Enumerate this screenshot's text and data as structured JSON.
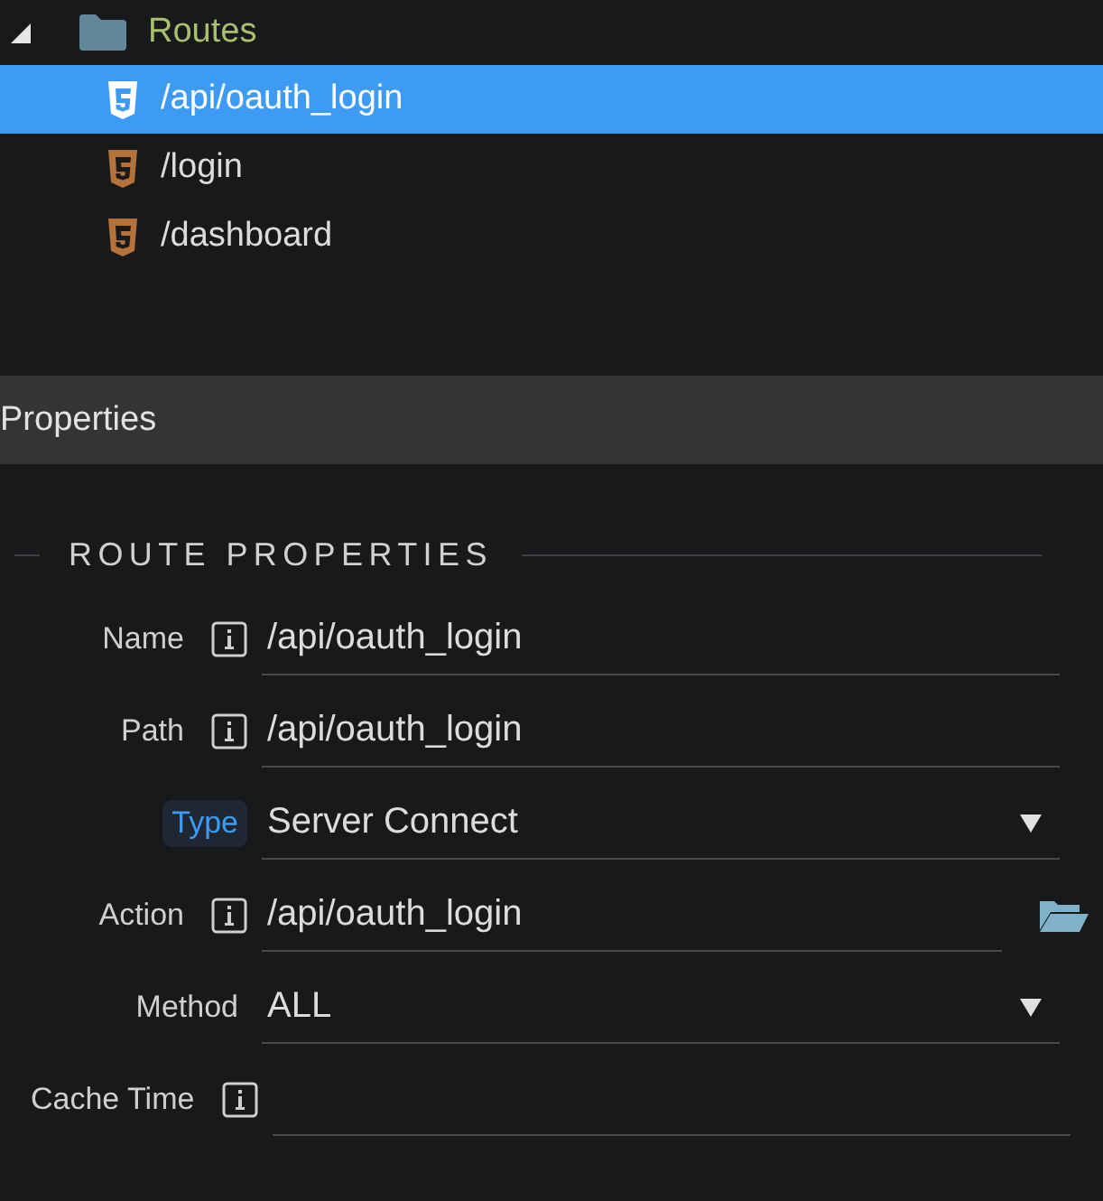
{
  "tree": {
    "folder": {
      "label": "Routes",
      "expanded": true
    },
    "items": [
      {
        "label": "/api/oauth_login",
        "selected": true
      },
      {
        "label": "/login",
        "selected": false
      },
      {
        "label": "/dashboard",
        "selected": false
      }
    ]
  },
  "panel": {
    "title": "Properties"
  },
  "section": {
    "title": "ROUTE PROPERTIES"
  },
  "fields": [
    {
      "label": "Name",
      "info": true,
      "kind": "text",
      "value": "/api/oauth_login",
      "highlighted": false
    },
    {
      "label": "Path",
      "info": true,
      "kind": "text",
      "value": "/api/oauth_login",
      "highlighted": false
    },
    {
      "label": "Type",
      "info": false,
      "kind": "select",
      "value": "Server Connect",
      "highlighted": true
    },
    {
      "label": "Action",
      "info": true,
      "kind": "file",
      "value": "/api/oauth_login",
      "highlighted": false
    },
    {
      "label": "Method",
      "info": false,
      "kind": "select",
      "value": "ALL",
      "highlighted": false
    },
    {
      "label": "Cache Time",
      "info": true,
      "kind": "text",
      "highlighted": false
    }
  ]
}
